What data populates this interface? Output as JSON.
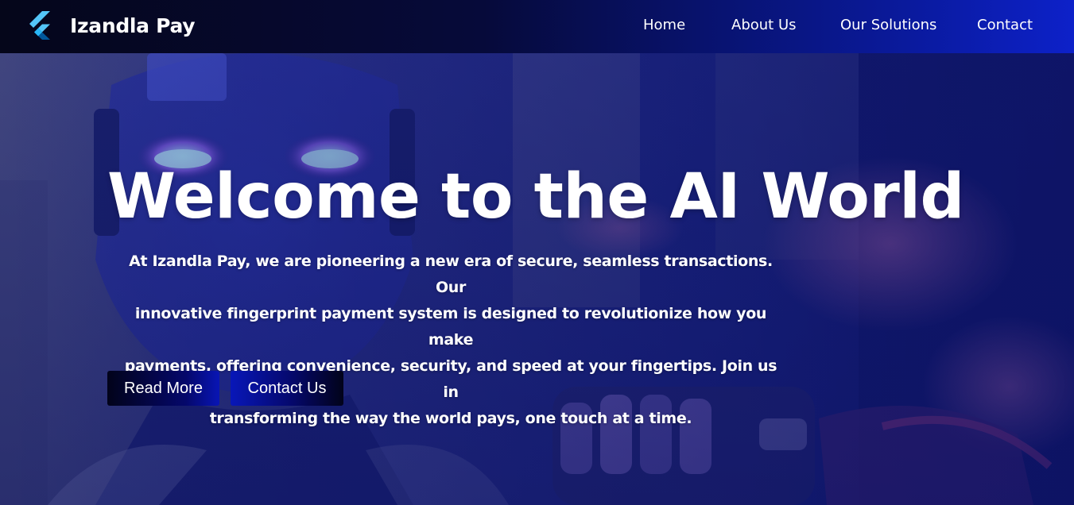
{
  "nav": {
    "brand": "Izandla Pay",
    "links": [
      {
        "label": "Home"
      },
      {
        "label": "About Us"
      },
      {
        "label": "Our Solutions"
      },
      {
        "label": "Contact"
      }
    ]
  },
  "hero": {
    "title": "Welcome to the AI World",
    "description_lines": [
      "At Izandla Pay, we are pioneering a new era of secure, seamless transactions. Our",
      "innovative fingerprint payment system is designed to revolutionize how you make",
      "payments, offering convenience, security, and speed at your fingertips. Join us in",
      "transforming the way the world pays, one touch at a time."
    ],
    "buttons": {
      "read_more": "Read More",
      "contact_us": "Contact Us"
    }
  },
  "colors": {
    "nav_start": "#05061a",
    "nav_end": "#0d21c9",
    "hero_tint": "#1a2a9e",
    "logo_light": "#54c5f8",
    "logo_dark": "#01579b"
  },
  "icons": {
    "logo": "flutter-logo-icon"
  }
}
